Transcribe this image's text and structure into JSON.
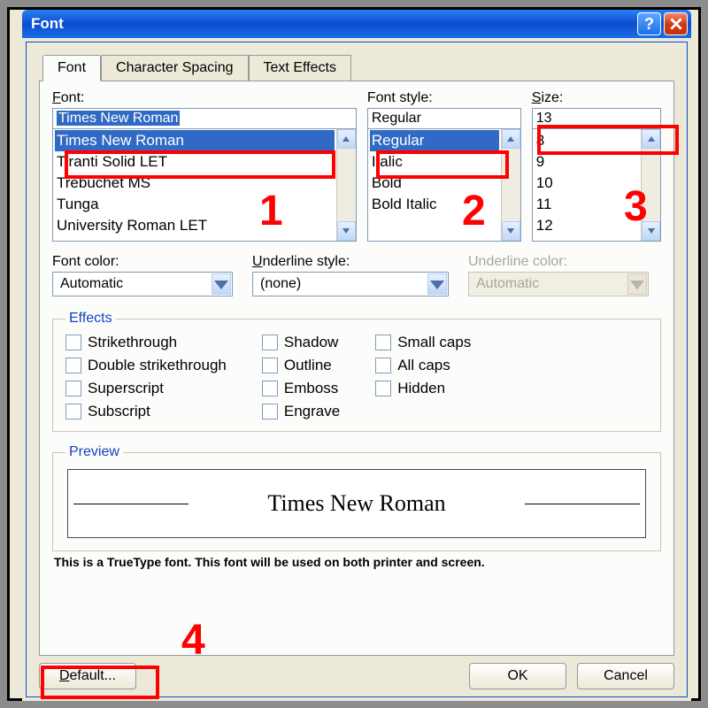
{
  "window": {
    "title": "Font"
  },
  "tabs": {
    "font": "Font",
    "spacing": "Character Spacing",
    "effects": "Text Effects"
  },
  "labels": {
    "font": "Font:",
    "style": "Font style:",
    "size": "Size:",
    "font_color": "Font color:",
    "underline_style": "Underline style:",
    "underline_color": "Underline color:"
  },
  "values": {
    "font": "Times New Roman",
    "style": "Regular",
    "size": "13",
    "font_color": "Automatic",
    "underline_style": "(none)",
    "underline_color": "Automatic"
  },
  "font_list": [
    "Times New Roman",
    "Tiranti Solid LET",
    "Trebuchet MS",
    "Tunga",
    "University Roman LET"
  ],
  "style_list": [
    "Regular",
    "Italic",
    "Bold",
    "Bold Italic"
  ],
  "size_list": [
    "8",
    "9",
    "10",
    "11",
    "12"
  ],
  "effects": {
    "legend": "Effects",
    "col1": [
      "Strikethrough",
      "Double strikethrough",
      "Superscript",
      "Subscript"
    ],
    "col2": [
      "Shadow",
      "Outline",
      "Emboss",
      "Engrave"
    ],
    "col3": [
      "Small caps",
      "All caps",
      "Hidden"
    ]
  },
  "preview": {
    "legend": "Preview",
    "text": "Times New Roman",
    "hint": "This is a TrueType font. This font will be used on both printer and screen."
  },
  "buttons": {
    "default": "Default...",
    "ok": "OK",
    "cancel": "Cancel"
  },
  "annotations": {
    "1": "1",
    "2": "2",
    "3": "3",
    "4": "4"
  }
}
